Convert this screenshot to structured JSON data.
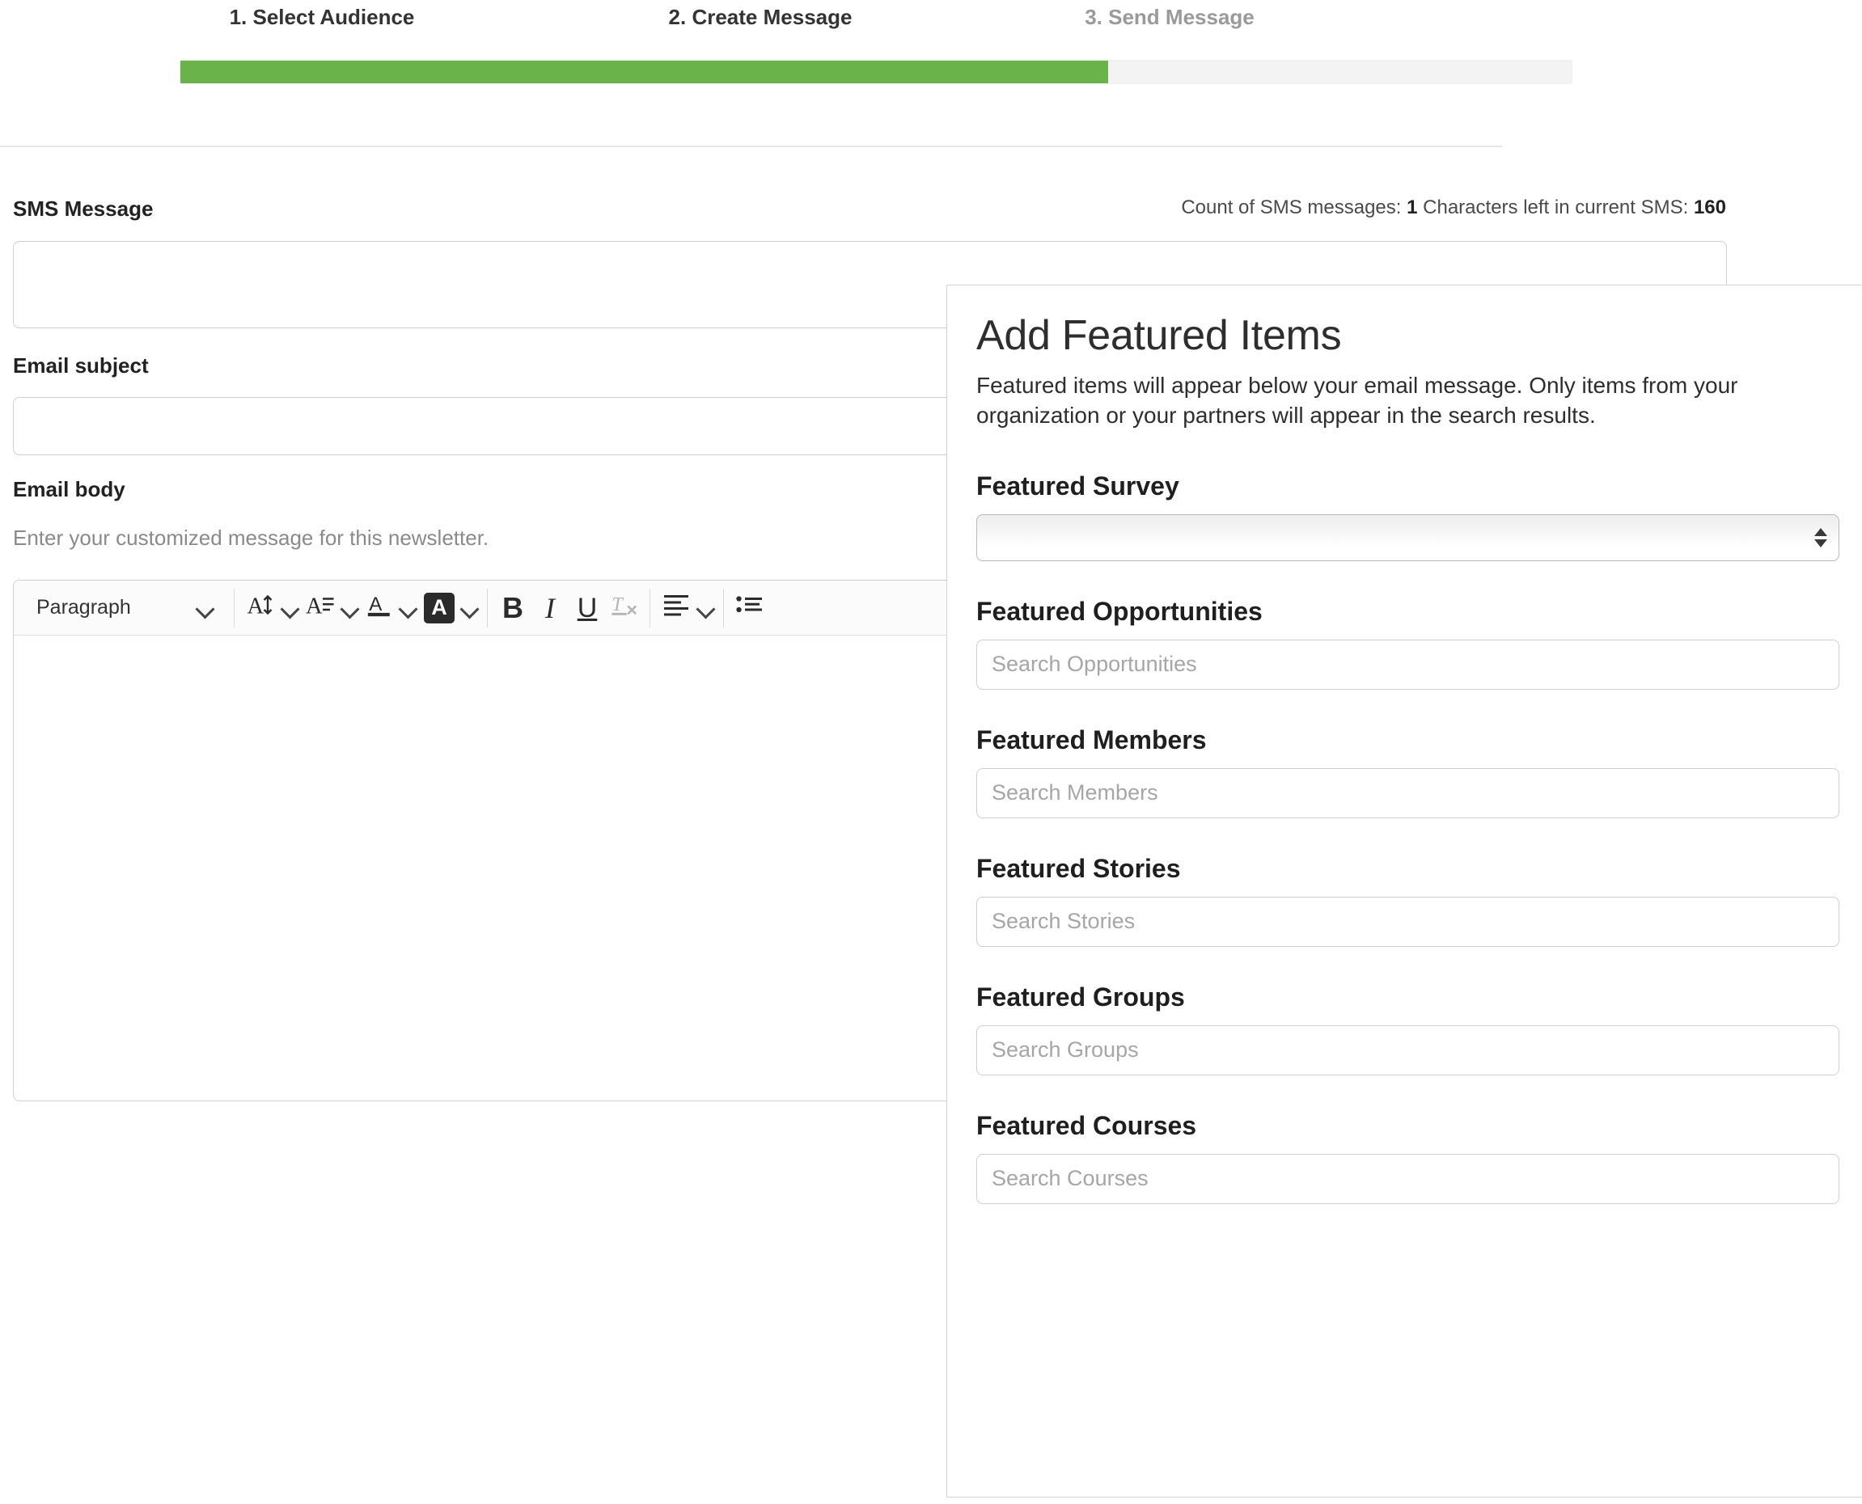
{
  "wizard": {
    "steps": [
      {
        "label": "1. Select Audience",
        "state": "done"
      },
      {
        "label": "2. Create Message",
        "state": "current"
      },
      {
        "label": "3. Send Message",
        "state": "upcoming"
      }
    ],
    "progress_percent": 66.7,
    "progress_color": "#6ab24a",
    "track_color": "#f3f3f3"
  },
  "form": {
    "sms_label": "SMS Message",
    "sms_value": "",
    "sms_count_prefix": "Count of SMS messages:",
    "sms_count_value": "1",
    "sms_chars_prefix": "Characters left in current SMS:",
    "sms_chars_value": "160",
    "subject_label": "Email subject",
    "subject_value": "",
    "body_label": "Email body",
    "body_helper": "Enter your customized message for this newsletter.",
    "body_value": ""
  },
  "editor_toolbar": {
    "block_format": "Paragraph",
    "buttons": [
      {
        "name": "font-size-icon",
        "glyph": "A↕"
      },
      {
        "name": "line-height-icon",
        "glyph": "A☰"
      },
      {
        "name": "text-color-icon",
        "glyph": "A"
      },
      {
        "name": "highlight-color-icon",
        "glyph": "A"
      },
      {
        "name": "bold-icon",
        "glyph": "B"
      },
      {
        "name": "italic-icon",
        "glyph": "I"
      },
      {
        "name": "underline-icon",
        "glyph": "U"
      },
      {
        "name": "clear-formatting-icon",
        "glyph": "Tₓ"
      },
      {
        "name": "align-icon",
        "glyph": "☰"
      },
      {
        "name": "bullet-list-icon",
        "glyph": "☰"
      }
    ]
  },
  "panel": {
    "title": "Add Featured Items",
    "description": "Featured items will appear below your email message. Only items from your organization or your partners will appear in the search results.",
    "sections": [
      {
        "title": "Featured Survey",
        "control": "select",
        "value": "",
        "placeholder": ""
      },
      {
        "title": "Featured Opportunities",
        "control": "search",
        "value": "",
        "placeholder": "Search Opportunities"
      },
      {
        "title": "Featured Members",
        "control": "search",
        "value": "",
        "placeholder": "Search Members"
      },
      {
        "title": "Featured Stories",
        "control": "search",
        "value": "",
        "placeholder": "Search Stories"
      },
      {
        "title": "Featured Groups",
        "control": "search",
        "value": "",
        "placeholder": "Search Groups"
      },
      {
        "title": "Featured Courses",
        "control": "search",
        "value": "",
        "placeholder": "Search Courses"
      }
    ]
  }
}
